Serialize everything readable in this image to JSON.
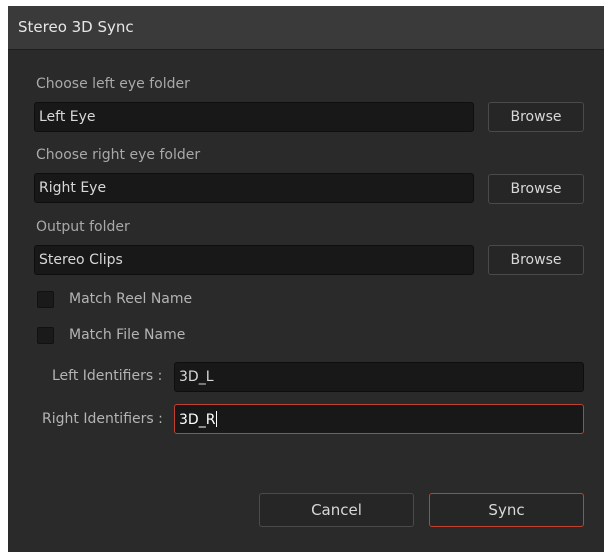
{
  "window": {
    "title": "Stereo 3D Sync"
  },
  "left_eye": {
    "label": "Choose left eye folder",
    "value": "Left Eye",
    "browse_label": "Browse"
  },
  "right_eye": {
    "label": "Choose right eye folder",
    "value": "Right Eye",
    "browse_label": "Browse"
  },
  "output": {
    "label": "Output folder",
    "value": "Stereo Clips",
    "browse_label": "Browse"
  },
  "options": {
    "match_reel_name": {
      "label": "Match Reel Name",
      "checked": false
    },
    "match_file_name": {
      "label": "Match File Name",
      "checked": false
    }
  },
  "identifiers": {
    "left_label": "Left Identifiers :",
    "left_value": "3D_L",
    "right_label": "Right Identifiers :",
    "right_value": "3D_R"
  },
  "footer": {
    "cancel_label": "Cancel",
    "sync_label": "Sync"
  },
  "colors": {
    "dialog_background": "#2a2a2a",
    "titlebar_background": "#3a3a3a",
    "field_background": "#181818",
    "accent": "#c0412f"
  }
}
